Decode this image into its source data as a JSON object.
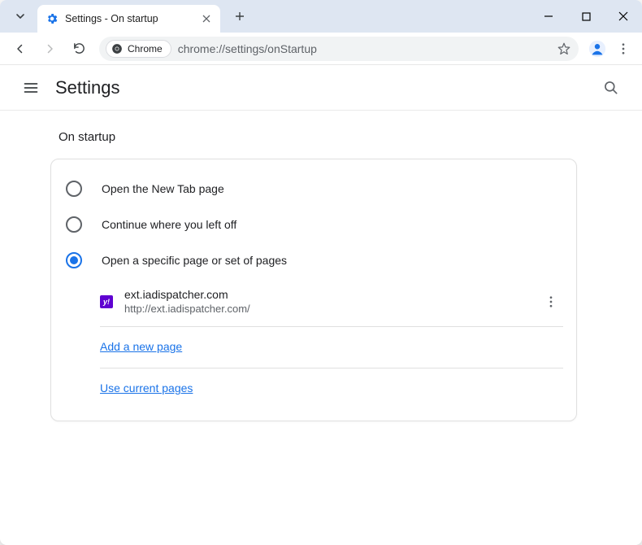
{
  "browser": {
    "tab_title": "Settings - On startup",
    "chrome_chip": "Chrome",
    "url": "chrome://settings/onStartup"
  },
  "settings": {
    "header_title": "Settings",
    "section_title": "On startup",
    "radios": {
      "new_tab": "Open the New Tab page",
      "continue": "Continue where you left off",
      "specific": "Open a specific page or set of pages"
    },
    "startup_page": {
      "title": "ext.iadispatcher.com",
      "url": "http://ext.iadispatcher.com/",
      "favicon_letter": "y!"
    },
    "add_new_page": "Add a new page",
    "use_current_pages": "Use current pages"
  }
}
